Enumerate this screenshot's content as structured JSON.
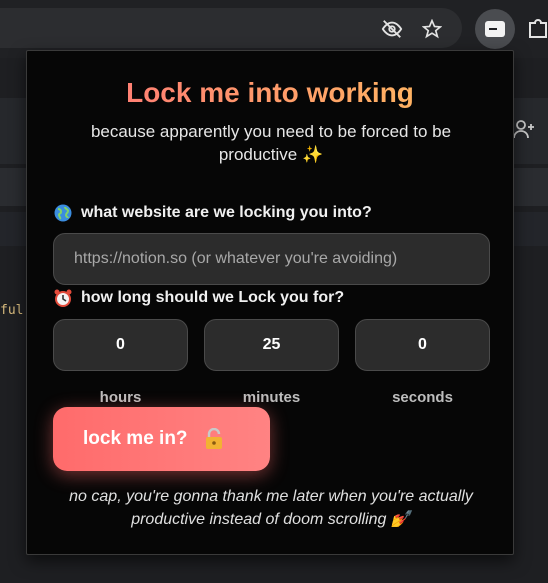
{
  "popup": {
    "title": "Lock me into working",
    "subtitle": "because apparently you need to be forced to be productive ✨",
    "website_label": "what website are we locking you into?",
    "website_placeholder": "https://notion.so (or whatever you're avoiding)",
    "duration_label": "how long should we Lock you for?",
    "hours_value": "0",
    "minutes_value": "25",
    "seconds_value": "0",
    "hours_label": "hours",
    "minutes_label": "minutes",
    "seconds_label": "seconds",
    "lock_button_label": "lock me in?",
    "footer_text": "no cap, you're gonna thank me later when you're actually productive instead of doom scrolling 💅",
    "accent_gradient": [
      "#ff6f7a",
      "#ff9a6a",
      "#ffc35e"
    ],
    "button_color": "#ff6b6b"
  },
  "background": {
    "code_fragment": "ful"
  },
  "icons": {
    "toolbar": [
      "eye-off-icon",
      "star-icon",
      "extension-active-icon",
      "puzzle-icon"
    ],
    "popup": [
      "globe-icon",
      "alarm-clock-icon",
      "lock-icon"
    ]
  }
}
